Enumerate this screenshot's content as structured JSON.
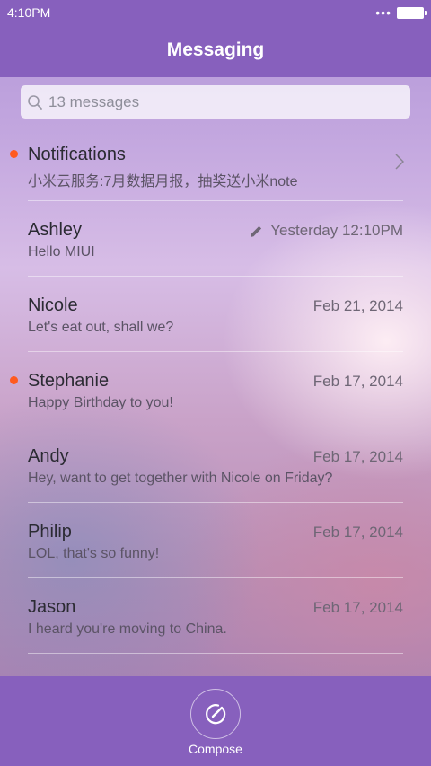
{
  "status": {
    "time": "4:10PM",
    "signal": "•••"
  },
  "header": {
    "title": "Messaging"
  },
  "search": {
    "placeholder": "13 messages"
  },
  "threads": [
    {
      "name": "Notifications",
      "preview": "小米云服务:7月数据月报，抽奖送小米note",
      "date": "",
      "unread": true,
      "draft": false,
      "chevron": true
    },
    {
      "name": "Ashley",
      "preview": "Hello MIUI",
      "date": "Yesterday 12:10PM",
      "unread": false,
      "draft": true,
      "chevron": false
    },
    {
      "name": "Nicole",
      "preview": "Let's eat out, shall we?",
      "date": "Feb 21, 2014",
      "unread": false,
      "draft": false,
      "chevron": false
    },
    {
      "name": "Stephanie",
      "preview": "Happy Birthday to you!",
      "date": "Feb 17, 2014",
      "unread": true,
      "draft": false,
      "chevron": false
    },
    {
      "name": "Andy",
      "preview": "Hey, want to get together with Nicole on Friday?",
      "date": "Feb 17, 2014",
      "unread": false,
      "draft": false,
      "chevron": false
    },
    {
      "name": "Philip",
      "preview": "LOL, that's so funny!",
      "date": "Feb 17, 2014",
      "unread": false,
      "draft": false,
      "chevron": false
    },
    {
      "name": "Jason",
      "preview": "I heard you're moving to China.",
      "date": "Feb 17, 2014",
      "unread": false,
      "draft": false,
      "chevron": false
    }
  ],
  "footer": {
    "compose_label": "Compose"
  },
  "colors": {
    "bar": "#8760bd",
    "unread_dot": "#ff5a1f"
  },
  "icons": {
    "search": "search-icon",
    "draft": "pencil-icon",
    "chevron": "chevron-right-icon",
    "compose": "compose-icon",
    "battery": "battery-icon"
  }
}
